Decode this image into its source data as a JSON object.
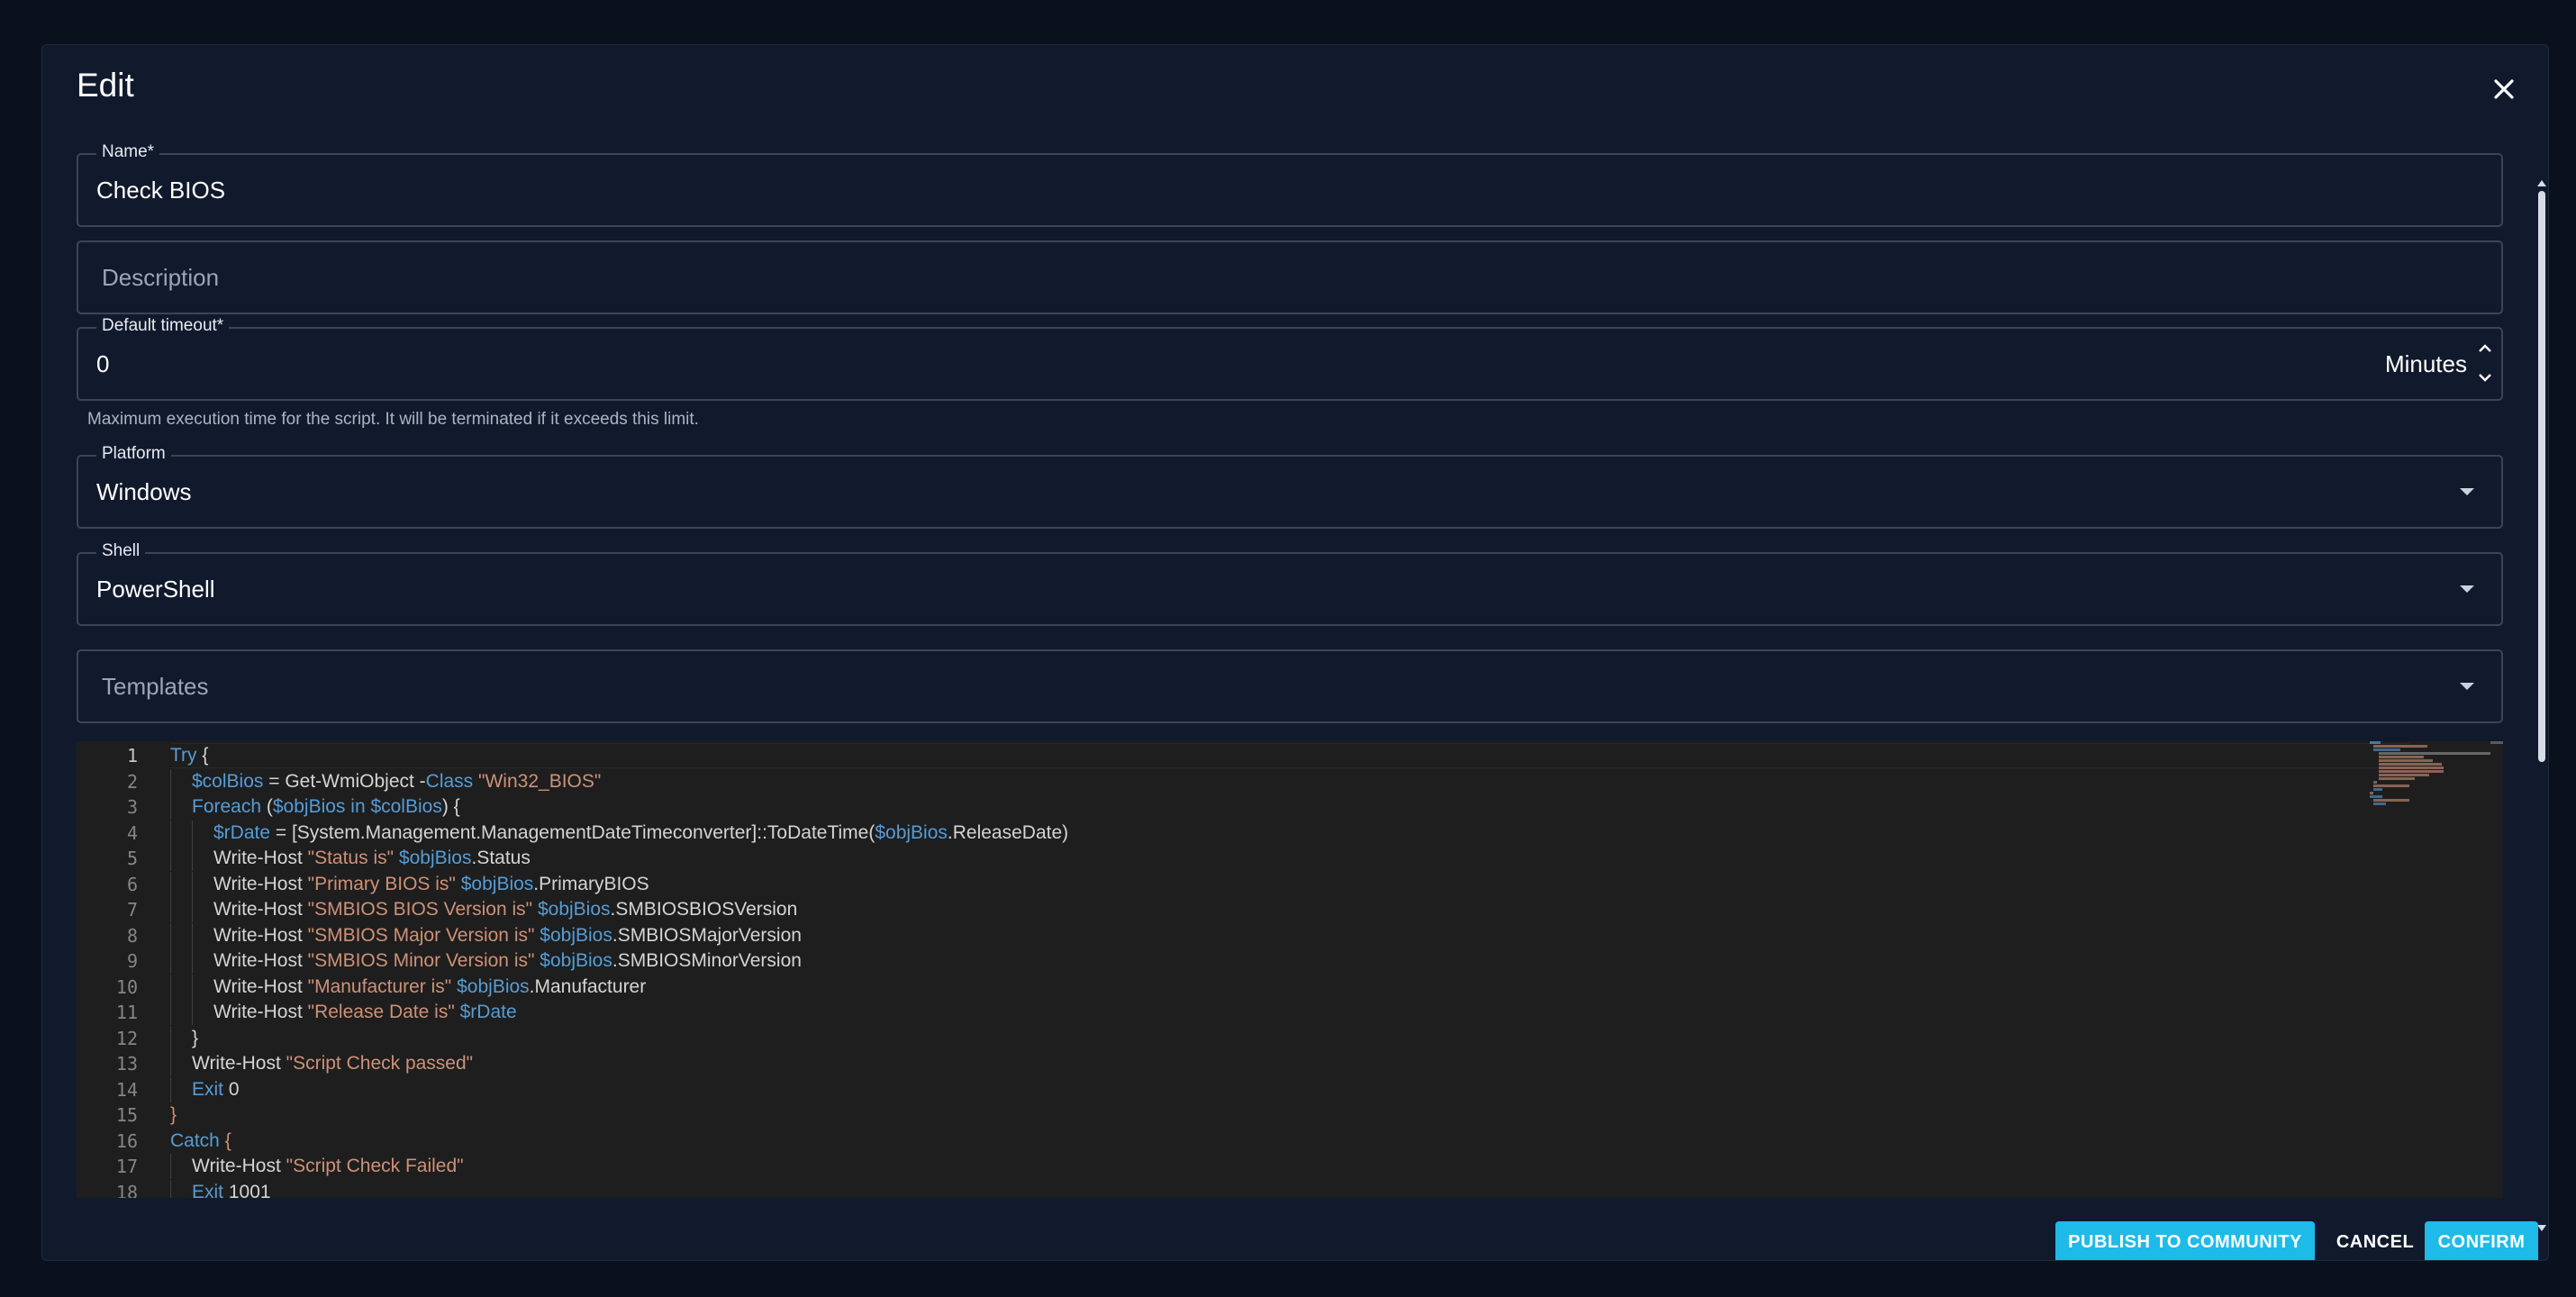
{
  "dialog": {
    "title": "Edit"
  },
  "form": {
    "name": {
      "label": "Name*",
      "value": "Check BIOS"
    },
    "description": {
      "placeholder": "Description"
    },
    "timeout": {
      "label": "Default timeout*",
      "value": "0",
      "unit": "Minutes",
      "helper": "Maximum execution time for the script. It will be terminated if it exceeds this limit."
    },
    "platform": {
      "label": "Platform",
      "value": "Windows"
    },
    "shell": {
      "label": "Shell",
      "value": "PowerShell"
    },
    "templates": {
      "placeholder": "Templates"
    }
  },
  "editor": {
    "active_line": 1,
    "lines": [
      {
        "n": "1",
        "indent": 0,
        "tokens": [
          {
            "t": "Try",
            "c": "kw"
          },
          {
            "t": " {",
            "c": "plain"
          }
        ]
      },
      {
        "n": "2",
        "indent": 1,
        "tokens": [
          {
            "t": "$colBios",
            "c": "var"
          },
          {
            "t": " = Get-WmiObject -",
            "c": "plain"
          },
          {
            "t": "Class",
            "c": "kw"
          },
          {
            "t": " ",
            "c": "plain"
          },
          {
            "t": "\"Win32_BIOS\"",
            "c": "str"
          }
        ]
      },
      {
        "n": "3",
        "indent": 1,
        "tokens": [
          {
            "t": "Foreach",
            "c": "kw"
          },
          {
            "t": " (",
            "c": "plain"
          },
          {
            "t": "$objBios",
            "c": "var"
          },
          {
            "t": " in ",
            "c": "kw"
          },
          {
            "t": "$colBios",
            "c": "var"
          },
          {
            "t": ") {",
            "c": "plain"
          }
        ]
      },
      {
        "n": "4",
        "indent": 2,
        "tokens": [
          {
            "t": "$rDate",
            "c": "var"
          },
          {
            "t": " = [System.Management.ManagementDateTimeconverter]::ToDateTime(",
            "c": "plain"
          },
          {
            "t": "$objBios",
            "c": "var"
          },
          {
            "t": ".ReleaseDate)",
            "c": "plain"
          }
        ]
      },
      {
        "n": "5",
        "indent": 2,
        "tokens": [
          {
            "t": "Write-Host ",
            "c": "plain"
          },
          {
            "t": "\"Status is\"",
            "c": "str"
          },
          {
            "t": " ",
            "c": "plain"
          },
          {
            "t": "$objBios",
            "c": "var"
          },
          {
            "t": ".Status",
            "c": "plain"
          }
        ]
      },
      {
        "n": "6",
        "indent": 2,
        "tokens": [
          {
            "t": "Write-Host ",
            "c": "plain"
          },
          {
            "t": "\"Primary BIOS is\"",
            "c": "str"
          },
          {
            "t": " ",
            "c": "plain"
          },
          {
            "t": "$objBios",
            "c": "var"
          },
          {
            "t": ".PrimaryBIOS",
            "c": "plain"
          }
        ]
      },
      {
        "n": "7",
        "indent": 2,
        "tokens": [
          {
            "t": "Write-Host ",
            "c": "plain"
          },
          {
            "t": "\"SMBIOS BIOS Version is\"",
            "c": "str"
          },
          {
            "t": " ",
            "c": "plain"
          },
          {
            "t": "$objBios",
            "c": "var"
          },
          {
            "t": ".SMBIOSBIOSVersion",
            "c": "plain"
          }
        ]
      },
      {
        "n": "8",
        "indent": 2,
        "tokens": [
          {
            "t": "Write-Host ",
            "c": "plain"
          },
          {
            "t": "\"SMBIOS Major Version is\"",
            "c": "str"
          },
          {
            "t": " ",
            "c": "plain"
          },
          {
            "t": "$objBios",
            "c": "var"
          },
          {
            "t": ".SMBIOSMajorVersion",
            "c": "plain"
          }
        ]
      },
      {
        "n": "9",
        "indent": 2,
        "tokens": [
          {
            "t": "Write-Host ",
            "c": "plain"
          },
          {
            "t": "\"SMBIOS Minor Version is\"",
            "c": "str"
          },
          {
            "t": " ",
            "c": "plain"
          },
          {
            "t": "$objBios",
            "c": "var"
          },
          {
            "t": ".SMBIOSMinorVersion",
            "c": "plain"
          }
        ]
      },
      {
        "n": "10",
        "indent": 2,
        "tokens": [
          {
            "t": "Write-Host ",
            "c": "plain"
          },
          {
            "t": "\"Manufacturer is\"",
            "c": "str"
          },
          {
            "t": " ",
            "c": "plain"
          },
          {
            "t": "$objBios",
            "c": "var"
          },
          {
            "t": ".Manufacturer",
            "c": "plain"
          }
        ]
      },
      {
        "n": "11",
        "indent": 2,
        "tokens": [
          {
            "t": "Write-Host ",
            "c": "plain"
          },
          {
            "t": "\"Release Date is\"",
            "c": "str"
          },
          {
            "t": " ",
            "c": "plain"
          },
          {
            "t": "$rDate",
            "c": "var"
          }
        ]
      },
      {
        "n": "12",
        "indent": 1,
        "tokens": [
          {
            "t": "}",
            "c": "plain"
          }
        ]
      },
      {
        "n": "13",
        "indent": 1,
        "tokens": [
          {
            "t": "Write-Host ",
            "c": "plain"
          },
          {
            "t": "\"Script Check passed\"",
            "c": "str"
          }
        ]
      },
      {
        "n": "14",
        "indent": 1,
        "tokens": [
          {
            "t": "Exit",
            "c": "kw"
          },
          {
            "t": " 0",
            "c": "plain"
          }
        ]
      },
      {
        "n": "15",
        "indent": 0,
        "tokens": [
          {
            "t": "}",
            "c": "str"
          }
        ]
      },
      {
        "n": "16",
        "indent": 0,
        "tokens": [
          {
            "t": "Catch",
            "c": "kw"
          },
          {
            "t": " {",
            "c": "str"
          }
        ]
      },
      {
        "n": "17",
        "indent": 1,
        "tokens": [
          {
            "t": "Write-Host ",
            "c": "plain"
          },
          {
            "t": "\"Script Check Failed\"",
            "c": "str"
          }
        ]
      },
      {
        "n": "18",
        "indent": 1,
        "tokens": [
          {
            "t": "Exit",
            "c": "kw"
          },
          {
            "t": " 1001",
            "c": "plain"
          }
        ]
      }
    ]
  },
  "footer": {
    "publish_label": "PUBLISH TO COMMUNITY",
    "cancel_label": "CANCEL",
    "confirm_label": "CONFIRM"
  },
  "colors": {
    "accent": "#1ebbe8",
    "keyword": "#569cd6",
    "string": "#ce9178",
    "dialog_bg": "#111a2c"
  },
  "icons": {
    "close": "close-icon",
    "stepper_up": "chevron-up-icon",
    "stepper_down": "chevron-down-icon",
    "dropdown": "caret-down-icon"
  }
}
